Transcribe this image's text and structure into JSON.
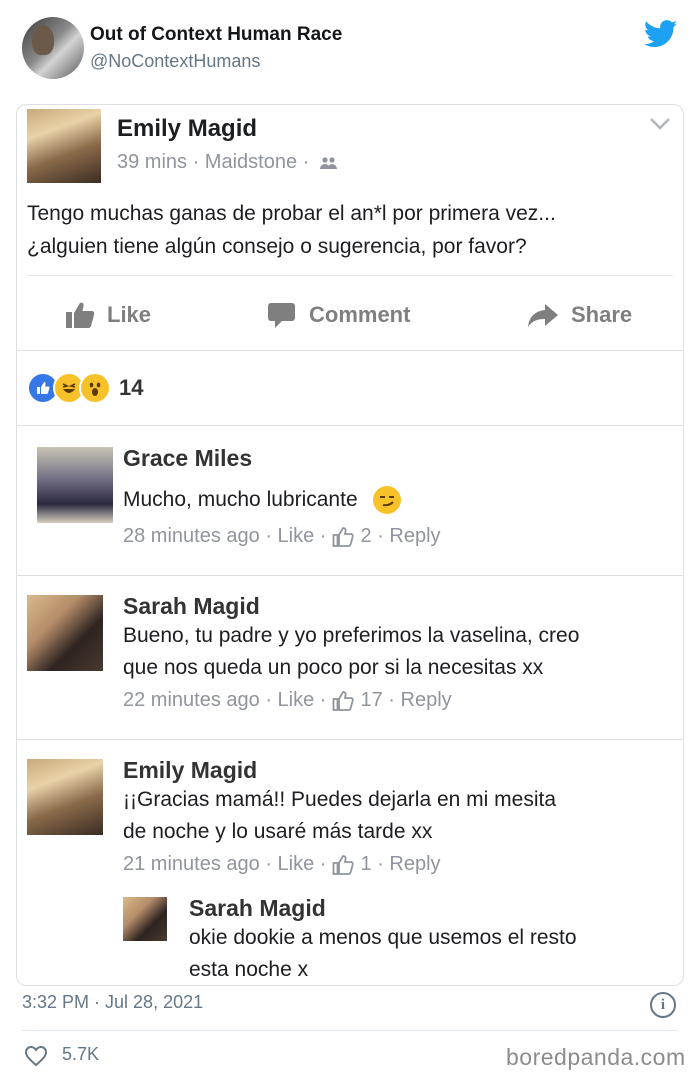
{
  "tweet": {
    "account_name": "Out of Context Human Race",
    "handle": "@NoContextHumans",
    "timestamp": "3:32 PM · Jul 28, 2021",
    "likes": "5.7K",
    "watermark": "boredpanda.com"
  },
  "post": {
    "author": "Emily Magid",
    "meta": "39 mins · Maidstone ·",
    "text_line1": "Tengo muchas ganas de probar el an*l por primera vez...",
    "text_line2": "¿alguien tiene algún consejo o sugerencia, por favor?",
    "actions": {
      "like": "Like",
      "comment": "Comment",
      "share": "Share"
    },
    "reaction_count": "14",
    "reactions": [
      "like-reaction",
      "haha-reaction",
      "wow-reaction"
    ]
  },
  "comments": [
    {
      "author": "Grace Miles",
      "text": "Mucho, mucho lubricante",
      "time": "28 minutes ago",
      "like": "Like",
      "likes": "2",
      "reply": "Reply"
    },
    {
      "author": "Sarah Magid",
      "text_line1": "Bueno, tu padre y yo preferimos la vaselina, creo",
      "text_line2": "que nos queda un poco por si la necesitas xx",
      "time": "22 minutes ago",
      "like": "Like",
      "likes": "17",
      "reply": "Reply"
    },
    {
      "author": "Emily Magid",
      "text_line1": "¡¡Gracias mamá!! Puedes dejarla en mi mesita",
      "text_line2": "de noche y lo usaré más tarde xx",
      "time": "21 minutes ago",
      "like": "Like",
      "likes": "1",
      "reply": "Reply"
    }
  ],
  "reply": {
    "author": "Sarah Magid",
    "text_line1": "okie dookie a menos que usemos el resto",
    "text_line2": "esta noche x"
  },
  "colors": {
    "twitter_blue": "#1da1f2",
    "fb_like_blue": "#3578e5",
    "fb_grey_text": "#90949c"
  }
}
